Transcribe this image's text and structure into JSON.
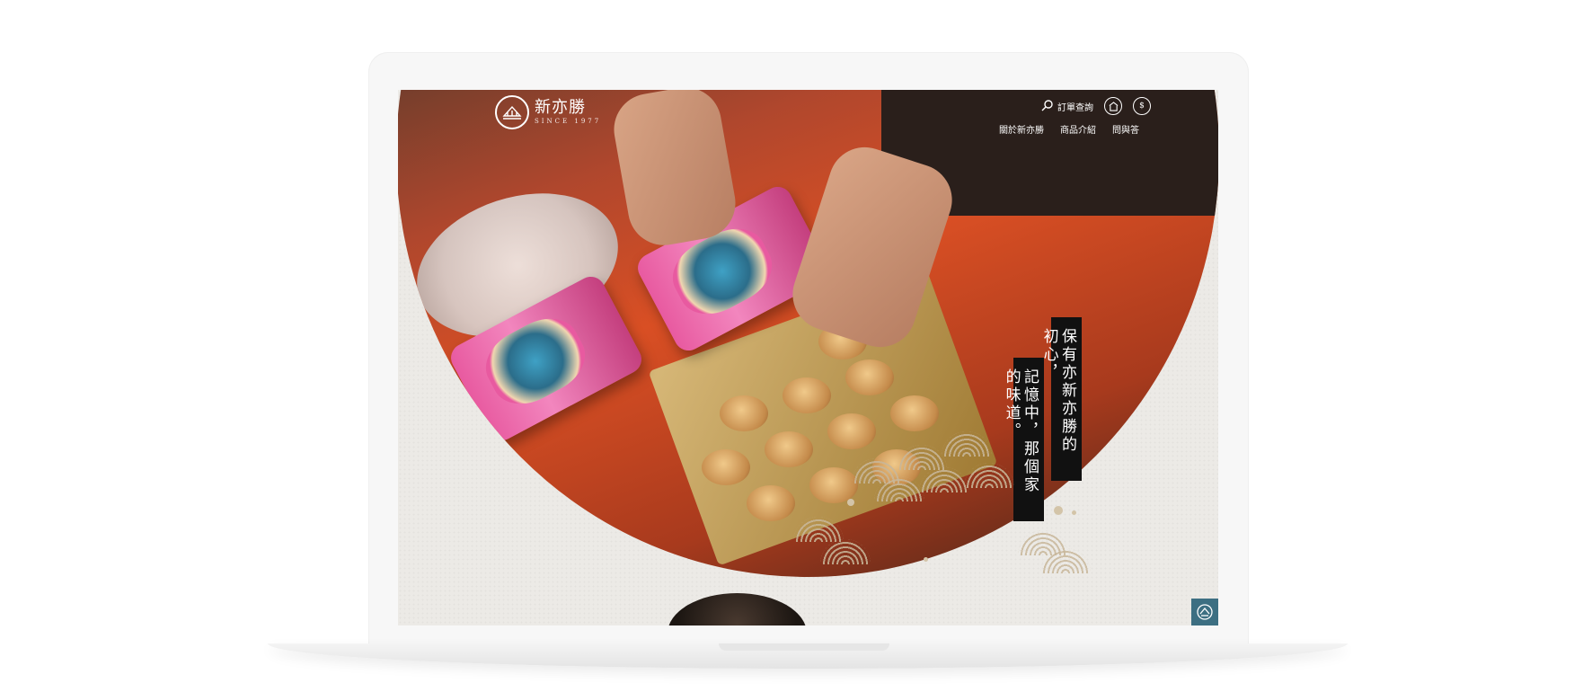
{
  "brand": {
    "name": "新亦勝",
    "since": "SINCE 1977"
  },
  "utility": {
    "order_query": "訂單查詢"
  },
  "nav": {
    "items": [
      "關於新亦勝",
      "商品介紹",
      "問與答"
    ]
  },
  "hero": {
    "line1": "保有亦新亦勝的初心，",
    "line2": "記憶中，那個家的味道。"
  },
  "colors": {
    "accent": "#3d6f82",
    "banner": "#111111",
    "wave": "#c8b79a"
  },
  "icons": [
    "search-icon",
    "shop-icon",
    "money-icon",
    "home-icon"
  ]
}
